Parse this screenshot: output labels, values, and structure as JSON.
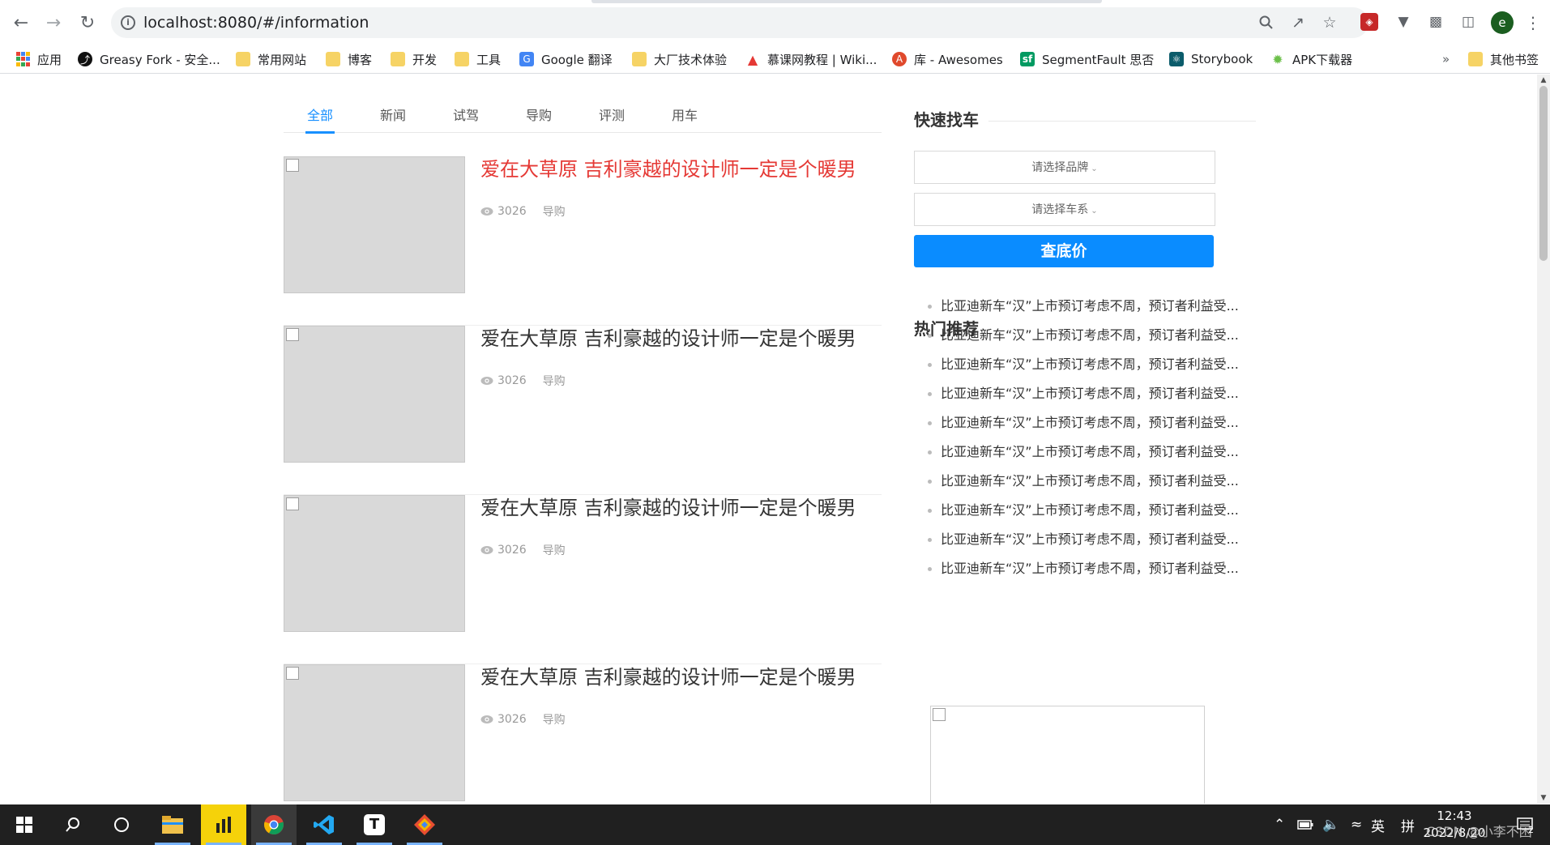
{
  "browser": {
    "url": "localhost:8080/#/information",
    "profile_initial": "e",
    "bookmarks": [
      {
        "label": "应用",
        "icon": "apps-grid-icon"
      },
      {
        "label": "Greasy Fork - 安全...",
        "icon": "greasyfork-icon"
      },
      {
        "label": "常用网站",
        "icon": "folder-icon"
      },
      {
        "label": "博客",
        "icon": "folder-icon"
      },
      {
        "label": "开发",
        "icon": "folder-icon"
      },
      {
        "label": "工具",
        "icon": "folder-icon"
      },
      {
        "label": "Google 翻译",
        "icon": "google-translate-icon"
      },
      {
        "label": "大厂技术体验",
        "icon": "folder-icon"
      },
      {
        "label": "慕课网教程 | Wiki...",
        "icon": "fire-icon"
      },
      {
        "label": "库 - Awesomes",
        "icon": "awesomes-icon"
      },
      {
        "label": "SegmentFault 思否",
        "icon": "segmentfault-icon"
      },
      {
        "label": "Storybook",
        "icon": "storybook-icon"
      },
      {
        "label": "APK下载器",
        "icon": "android-icon"
      }
    ],
    "more_bookmarks": "»",
    "other_bookmarks": "其他书签"
  },
  "tabs": [
    "全部",
    "新闻",
    "试驾",
    "导购",
    "评测",
    "用车"
  ],
  "active_tab": "全部",
  "articles": [
    {
      "title": "爱在大草原 吉利豪越的设计师一定是个暖男",
      "views": "3026",
      "category": "导购"
    },
    {
      "title": "爱在大草原 吉利豪越的设计师一定是个暖男",
      "views": "3026",
      "category": "导购"
    },
    {
      "title": "爱在大草原 吉利豪越的设计师一定是个暖男",
      "views": "3026",
      "category": "导购"
    },
    {
      "title": "爱在大草原 吉利豪越的设计师一定是个暖男",
      "views": "3026",
      "category": "导购"
    }
  ],
  "sidebar": {
    "quick_find_title": "快速找车",
    "brand_placeholder": "请选择品牌",
    "series_placeholder": "请选择车系",
    "price_button": "查底价",
    "hot_title": "热门推荐",
    "hot_items": [
      "比亚迪新车“汉”上市预订考虑不周，预订者利益受...",
      "比亚迪新车“汉”上市预订考虑不周，预订者利益受...",
      "比亚迪新车“汉”上市预订考虑不周，预订者利益受...",
      "比亚迪新车“汉”上市预订考虑不周，预订者利益受...",
      "比亚迪新车“汉”上市预订考虑不周，预订者利益受...",
      "比亚迪新车“汉”上市预订考虑不周，预订者利益受...",
      "比亚迪新车“汉”上市预订考虑不周，预订者利益受...",
      "比亚迪新车“汉”上市预订考虑不周，预订者利益受...",
      "比亚迪新车“汉”上市预订考虑不周，预订者利益受...",
      "比亚迪新车“汉”上市预订考虑不周，预订者利益受..."
    ]
  },
  "taskbar": {
    "ime_lang": "英",
    "ime_mode": "拼",
    "time": "12:43",
    "date": "2022/8/20",
    "watermark": "CSDN @小李不困",
    "notification_count": "2"
  },
  "colors": {
    "accent": "#1890ff",
    "button": "#0a8cff",
    "hot_title": "#e53935"
  }
}
